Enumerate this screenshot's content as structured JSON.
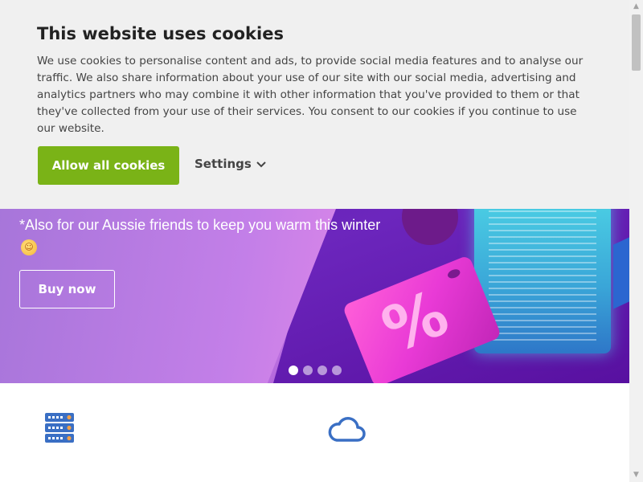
{
  "cookie_banner": {
    "title": "This website uses cookies",
    "text": "We use cookies to personalise content and ads, to provide social media features and to analyse our traffic. We also share information about your use of our site with our social media, advertising and analytics partners who may combine it with other information that you've provided to them or that they've collected from your use of their services. You consent to our cookies if you continue to use our website.",
    "allow_label": "Allow all cookies",
    "settings_label": "Settings",
    "allow_color": "#7ab317"
  },
  "hero": {
    "text": "*Also for our Aussie friends to keep you warm this winter",
    "emoji": "☺",
    "buy_label": "Buy now",
    "tag_symbol": "%",
    "slide_count": 4,
    "active_slide": 1
  },
  "features": {
    "icons": [
      "server-stack-icon",
      "cloud-icon"
    ],
    "icon_color": "#3a6fc4"
  }
}
